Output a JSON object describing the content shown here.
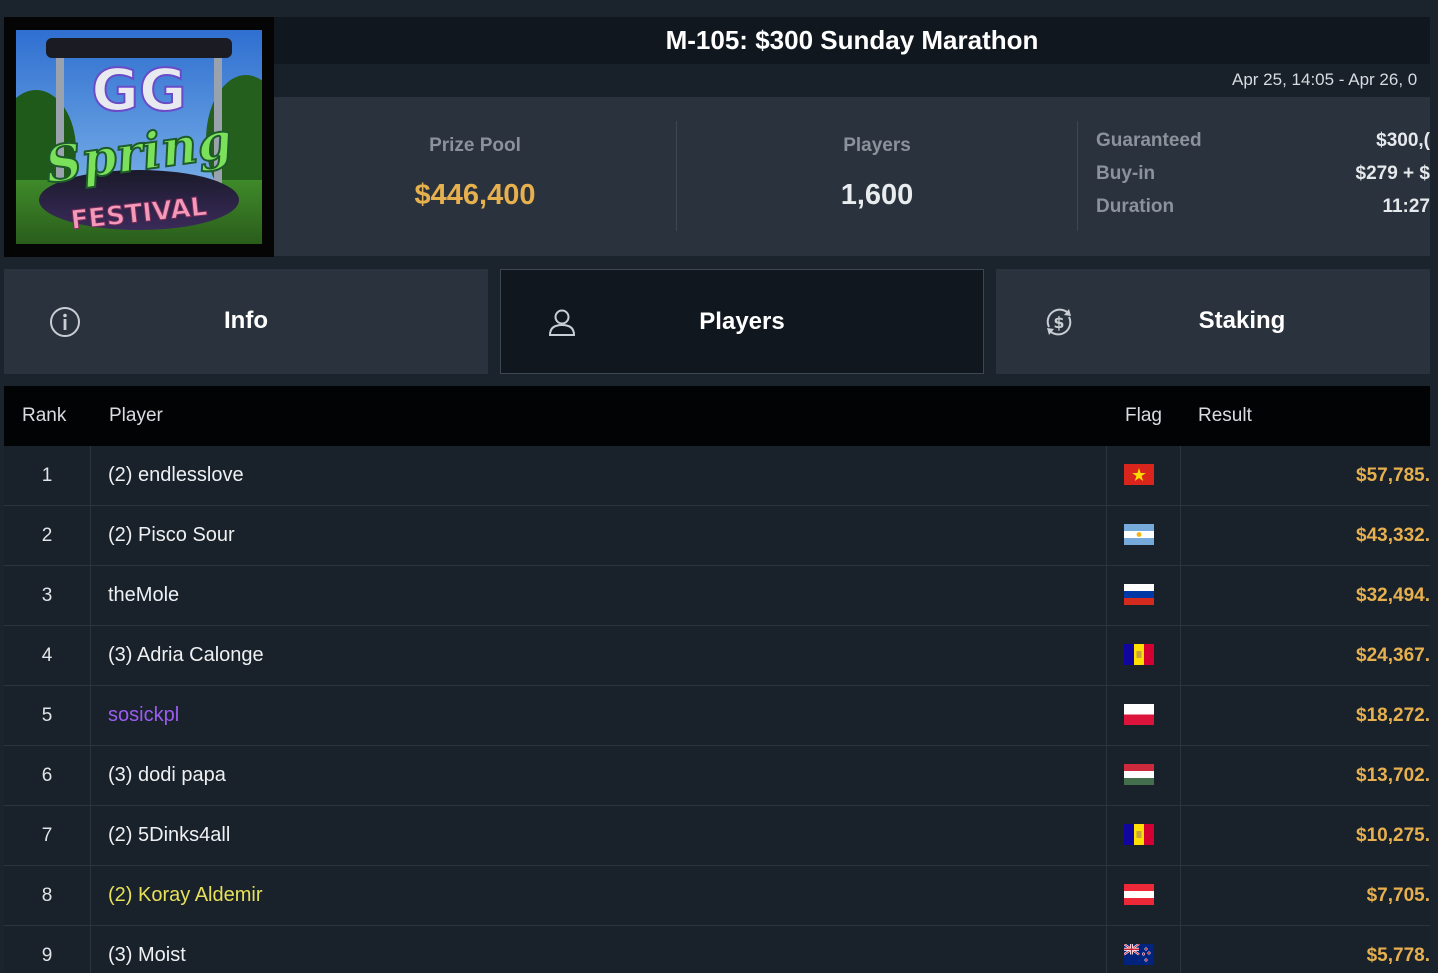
{
  "title": "M-105: $300 Sunday Marathon",
  "date_range": "Apr 25, 14:05 - Apr 26, 0",
  "logo": {
    "line1": "GG",
    "line2": "Spring",
    "line3": "FESTIVAL"
  },
  "stats": {
    "prize_pool_label": "Prize Pool",
    "prize_pool_value": "$446,400",
    "players_label": "Players",
    "players_value": "1,600"
  },
  "details": [
    {
      "key": "Guaranteed",
      "value": "$300,("
    },
    {
      "key": "Buy-in",
      "value": "$279 + $"
    },
    {
      "key": "Duration",
      "value": "11:27"
    }
  ],
  "tabs": [
    {
      "label": "Info",
      "icon": "info-icon",
      "active": false
    },
    {
      "label": "Players",
      "icon": "user-icon",
      "active": true
    },
    {
      "label": "Staking",
      "icon": "dollar-cycle-icon",
      "active": false
    }
  ],
  "table": {
    "headers": {
      "rank": "Rank",
      "player": "Player",
      "flag": "Flag",
      "result": "Result"
    },
    "rows": [
      {
        "rank": "1",
        "player": "(2) endlesslove",
        "flag": "vn",
        "result": "$57,785.",
        "player_color": "#eef0f2"
      },
      {
        "rank": "2",
        "player": "(2) Pisco Sour",
        "flag": "ar",
        "result": "$43,332.",
        "player_color": "#eef0f2"
      },
      {
        "rank": "3",
        "player": "theMole",
        "flag": "ru",
        "result": "$32,494.",
        "player_color": "#eef0f2"
      },
      {
        "rank": "4",
        "player": "(3) Adria Calonge",
        "flag": "ad",
        "result": "$24,367.",
        "player_color": "#eef0f2"
      },
      {
        "rank": "5",
        "player": "sosickpl",
        "flag": "pl",
        "result": "$18,272.",
        "player_color": "#9c5cf2"
      },
      {
        "rank": "6",
        "player": "(3) dodi papa",
        "flag": "hu",
        "result": "$13,702.",
        "player_color": "#eef0f2"
      },
      {
        "rank": "7",
        "player": "(2) 5Dinks4all",
        "flag": "ad",
        "result": "$10,275.",
        "player_color": "#eef0f2"
      },
      {
        "rank": "8",
        "player": "(2) Koray Aldemir",
        "flag": "at",
        "result": "$7,705.",
        "player_color": "#e6e05a"
      },
      {
        "rank": "9",
        "player": "(3) Moist",
        "flag": "nz",
        "result": "$5,778.",
        "player_color": "#eef0f2"
      }
    ]
  },
  "colors": {
    "accent_gold": "#e7b04e",
    "background": "#1b232d",
    "purple_highlight": "#9c5cf2",
    "yellow_highlight": "#e6e05a"
  }
}
